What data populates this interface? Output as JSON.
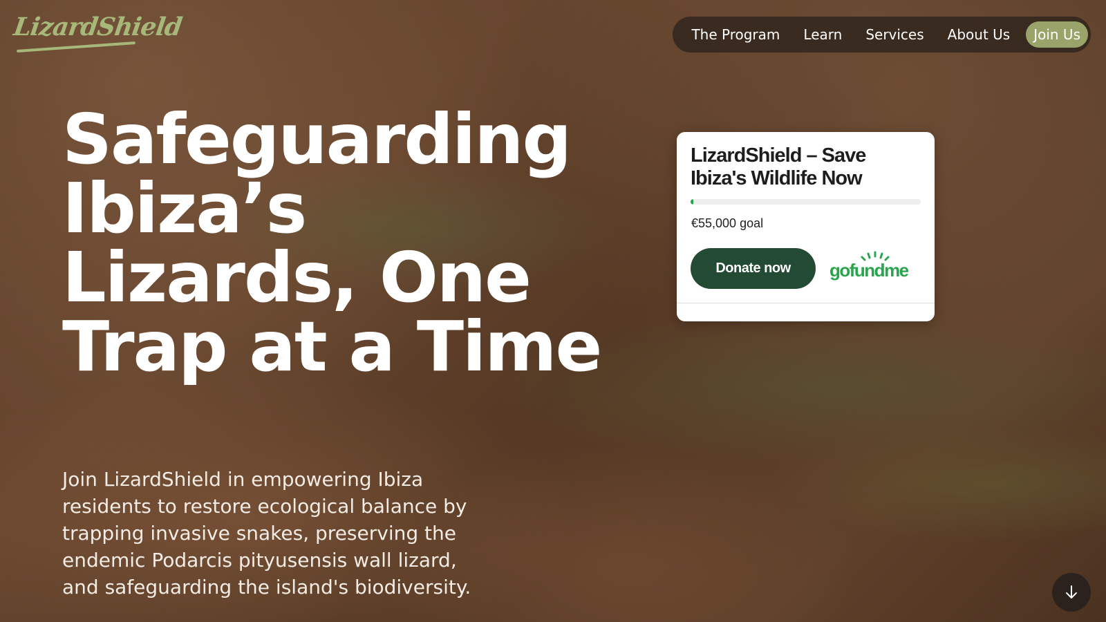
{
  "brand": {
    "logo_text": "LizardShield"
  },
  "nav": {
    "items": [
      {
        "label": "The Program"
      },
      {
        "label": "Learn"
      },
      {
        "label": "Services"
      },
      {
        "label": "About Us"
      }
    ],
    "cta_label": "Join Us"
  },
  "hero": {
    "title": "Safeguarding Ibiza’s Lizards, One Trap at a Time",
    "subtitle": "Join LizardShield in empowering Ibiza residents to restore ecological balance by trapping invasive snakes, preserving the endemic Podarcis pityusensis wall lizard, and safeguarding the island's biodiversity."
  },
  "fundraiser": {
    "title": "LizardShield – Save Ibiza's Wildlife Now",
    "progress_fraction": 0.012,
    "goal_text": "€55,000 goal",
    "donate_label": "Donate now",
    "platform_logo_text": "gofundme"
  },
  "colors": {
    "nav_cta": "#9aa46a",
    "logo": "#a7b97a",
    "donate_button": "#234a33",
    "gofundme_green": "#2ba44e"
  },
  "icons": {
    "scroll": "arrow-down-icon"
  }
}
